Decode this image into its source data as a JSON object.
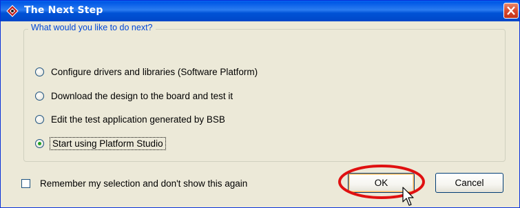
{
  "window": {
    "title": "The Next Step",
    "title_icon": "xilinx-logo-icon",
    "close_icon": "close-icon"
  },
  "group": {
    "legend": "What would you like to do next?",
    "options": [
      {
        "label": "Configure drivers and libraries (Software Platform)",
        "checked": false
      },
      {
        "label": "Download the design to the board and test it",
        "checked": false
      },
      {
        "label": "Edit the test application generated by BSB",
        "checked": false
      },
      {
        "label": "Start using Platform Studio",
        "checked": true
      }
    ]
  },
  "remember": {
    "label": "Remember my selection and don't show this again",
    "checked": false
  },
  "buttons": {
    "ok": "OK",
    "cancel": "Cancel"
  },
  "colors": {
    "titlebar": "#0058e6",
    "legend_text": "#0046d5",
    "annotation_ring": "#e01010",
    "radio_dot": "#21a121"
  }
}
